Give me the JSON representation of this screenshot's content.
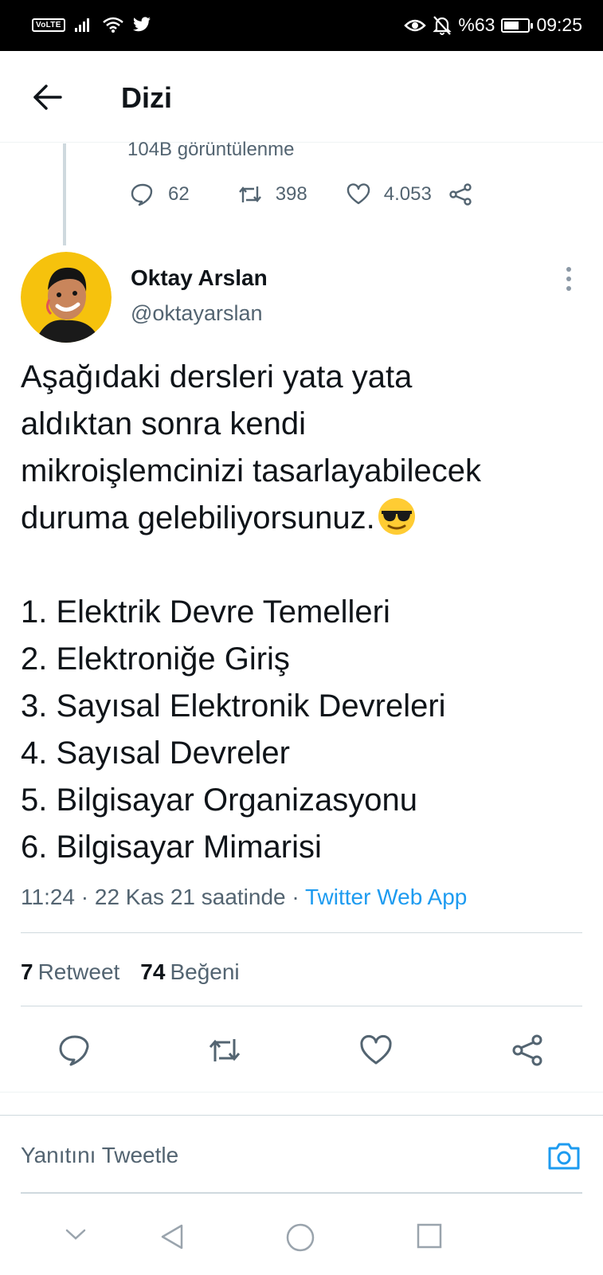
{
  "status_bar": {
    "volte": "VoLTE",
    "battery_percent": "%63",
    "battery_level": 0.63,
    "time": "09:25"
  },
  "header": {
    "title": "Dizi"
  },
  "previous_tweet": {
    "views": "104B görüntülenme",
    "replies": "62",
    "retweets": "398",
    "likes": "4.053"
  },
  "author": {
    "name": "Oktay Arslan",
    "handle": "@oktayarslan"
  },
  "tweet": {
    "intro": [
      "Aşağıdaki dersleri yata yata",
      "aldıktan sonra kendi",
      "mikroişlemcinizi tasarlayabilecek",
      "duruma gelebiliyorsunuz."
    ],
    "list": [
      "1. Elektrik Devre Temelleri",
      "2. Elektroniğe Giriş",
      "3. Sayısal Elektronik Devreleri",
      "4. Sayısal Devreler",
      "5. Bilgisayar Organizasyonu",
      "6. Bilgisayar Mimarisi"
    ],
    "timestamp": "11:24 · 22 Kas 21 saatinde · ",
    "source": "Twitter Web App"
  },
  "stats": {
    "retweet_count": "7",
    "retweet_label": "Retweet",
    "like_count": "74",
    "like_label": "Beğeni"
  },
  "reply": {
    "placeholder": "Yanıtını Tweetle"
  },
  "colors": {
    "accent": "#1d9bf0",
    "secondary_text": "#536471"
  }
}
